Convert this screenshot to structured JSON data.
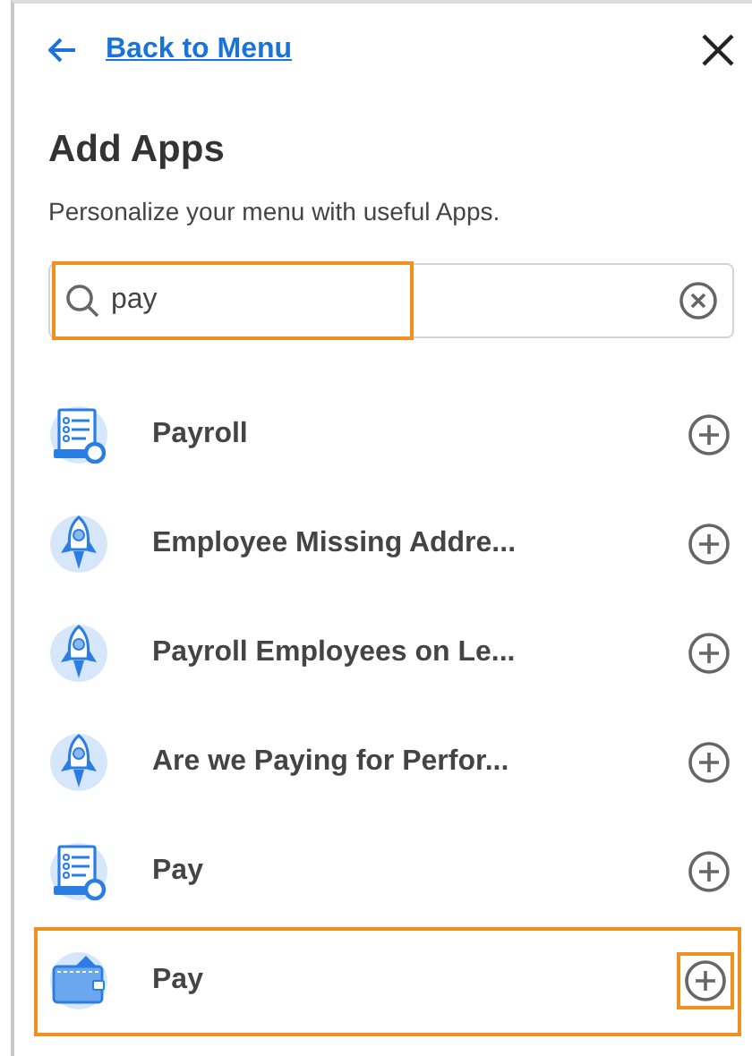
{
  "back_link": "Back to Menu",
  "title": "Add Apps",
  "subtitle": "Personalize your menu with useful Apps.",
  "search": {
    "value": "pay",
    "highlighted": true
  },
  "apps": [
    {
      "name": "Payroll",
      "kind": "report",
      "highlighted": false
    },
    {
      "name": "Employee Missing Addre...",
      "kind": "rocket",
      "highlighted": false
    },
    {
      "name": "Payroll Employees on Le...",
      "kind": "rocket",
      "highlighted": false
    },
    {
      "name": "Are we Paying for Perfor...",
      "kind": "rocket",
      "highlighted": false
    },
    {
      "name": "Pay",
      "kind": "report",
      "highlighted": false
    },
    {
      "name": "Pay",
      "kind": "wallet",
      "highlighted": true
    }
  ]
}
